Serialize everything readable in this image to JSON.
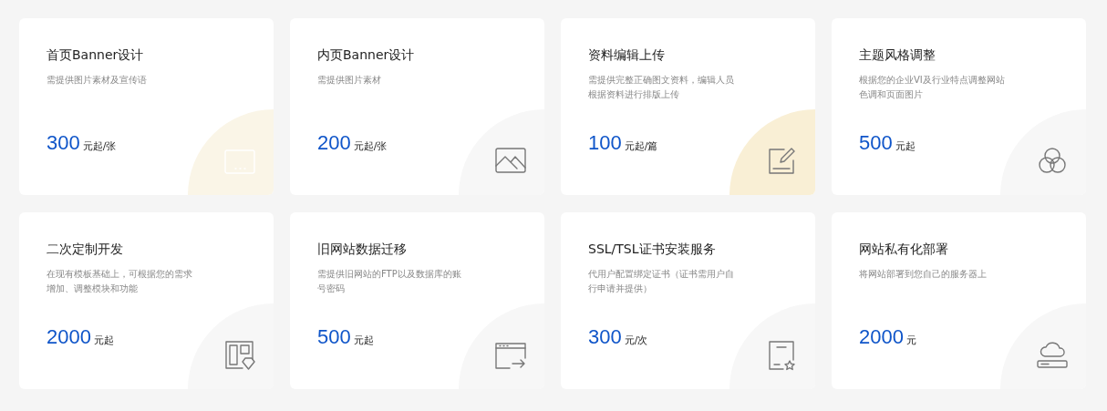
{
  "services": [
    {
      "title": "首页Banner设计",
      "description": [
        "需提供图片素材及宣传语"
      ],
      "price": "300",
      "unit": "元起/张",
      "kind": "banner",
      "color": "#faf5e7",
      "faded": true
    },
    {
      "title": "内页Banner设计",
      "description": [
        "需提供图片素材"
      ],
      "price": "200",
      "unit": "元起/张",
      "kind": "image",
      "color": "#f7f7f7",
      "faded": false
    },
    {
      "title": "资料编辑上传",
      "description": [
        "需提供完整正确图文资料，编辑人员",
        "根据资料进行排版上传"
      ],
      "price": "100",
      "unit": "元起/篇",
      "kind": "edit",
      "color": "#f9efd5",
      "faded": false
    },
    {
      "title": "主题风格调整",
      "description": [
        "根据您的企业VI及行业特点调整网站",
        "色调和页面图片"
      ],
      "price": "500",
      "unit": "元起",
      "kind": "circles",
      "color": "#f7f7f7",
      "faded": false
    },
    {
      "title": "二次定制开发",
      "description": [
        "在现有模板基础上，可根据您的需求",
        "增加、调整模块和功能"
      ],
      "price": "2000",
      "unit": "元起",
      "kind": "layout",
      "color": "#f7f7f7",
      "faded": false
    },
    {
      "title": "旧网站数据迁移",
      "description": [
        "需提供旧网站的FTP以及数据库的账",
        "号密码"
      ],
      "price": "500",
      "unit": "元起",
      "kind": "migrate",
      "color": "#f7f7f7",
      "faded": false
    },
    {
      "title": "SSL/TSL证书安装服务",
      "description": [
        "代用户配置绑定证书（证书需用户自",
        "行申请并提供）"
      ],
      "price": "300",
      "unit": "元/次",
      "kind": "certificate",
      "color": "#f7f7f7",
      "faded": false
    },
    {
      "title": "网站私有化部署",
      "description": [
        "将网站部署到您自己的服务器上"
      ],
      "price": "2000",
      "unit": "元",
      "kind": "cloud",
      "color": "#f7f7f7",
      "faded": false
    }
  ]
}
